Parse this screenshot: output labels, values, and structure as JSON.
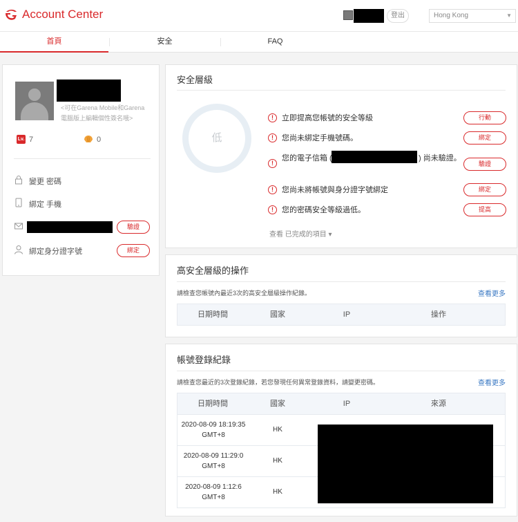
{
  "header": {
    "brand": "Account Center",
    "logout_label": "登出",
    "region_value": "Hong Kong",
    "brand_color": "#d9292b"
  },
  "tabs": [
    {
      "label": "首頁",
      "active": true
    },
    {
      "label": "安全",
      "active": false
    },
    {
      "label": "FAQ",
      "active": false
    }
  ],
  "profile": {
    "hint": "<可在Garena Mobile和Garena電腦版上編輯個性簽名哦>",
    "level_badge": "Lv.",
    "level": "7",
    "shells": "0",
    "items": [
      {
        "label": "變更 密碼",
        "icon": "lock-icon"
      },
      {
        "label": "綁定 手機",
        "icon": "phone-icon"
      },
      {
        "label": "",
        "icon": "mail-icon",
        "button": "驗證"
      },
      {
        "label": "綁定身分證字號",
        "icon": "person-icon",
        "button": "綁定"
      }
    ]
  },
  "security": {
    "title": "安全層級",
    "level_text": "低",
    "warnings": [
      {
        "text": "立即提高您帳號的安全等級",
        "button": "行動"
      },
      {
        "text": "您尚未綁定手機號碼。",
        "button": "綁定"
      },
      {
        "text_before": "您的電子信箱 (",
        "text_after": ") 尚未驗證。",
        "button": "驗證"
      },
      {
        "text": "您尚未將帳號與身分證字號綁定",
        "button": "綁定"
      },
      {
        "text": "您的密碼安全等級過低。",
        "button": "提高"
      }
    ],
    "view_completed": "查看 已完成的項目 ▾"
  },
  "high_security_ops": {
    "title": "高安全層級的操作",
    "description": "請檢查您帳號內最近3次的高安全層級操作紀錄。",
    "more": "查看更多",
    "columns": [
      "日期時間",
      "國家",
      "IP",
      "操作"
    ]
  },
  "login_records": {
    "title": "帳號登錄紀錄",
    "description": "請檢查您最近的3次登錄紀錄，若您發現任何異常登錄資料，請變更密碼。",
    "more": "查看更多",
    "columns": [
      "日期時間",
      "國家",
      "IP",
      "來源"
    ],
    "rows": [
      {
        "datetime": "2020-08-09 18:19:35",
        "tz": "GMT+8",
        "country": "HK"
      },
      {
        "datetime": "2020-08-09 11:29:0",
        "tz": "GMT+8",
        "country": "HK"
      },
      {
        "datetime": "2020-08-09 1:12:6",
        "tz": "GMT+8",
        "country": "HK"
      }
    ]
  }
}
